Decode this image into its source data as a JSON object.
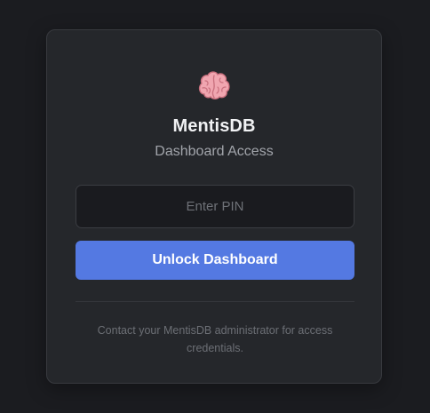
{
  "login": {
    "logo_icon": "brain-icon",
    "title": "MentisDB",
    "subtitle": "Dashboard Access",
    "pin_placeholder": "Enter PIN",
    "pin_value": "",
    "unlock_label": "Unlock Dashboard",
    "footer_note": "Contact your MentisDB administrator for access credentials."
  },
  "colors": {
    "page_background": "#1b1c20",
    "card_background": "#25272b",
    "accent": "#5479e2",
    "input_background": "#1a1b1f"
  }
}
